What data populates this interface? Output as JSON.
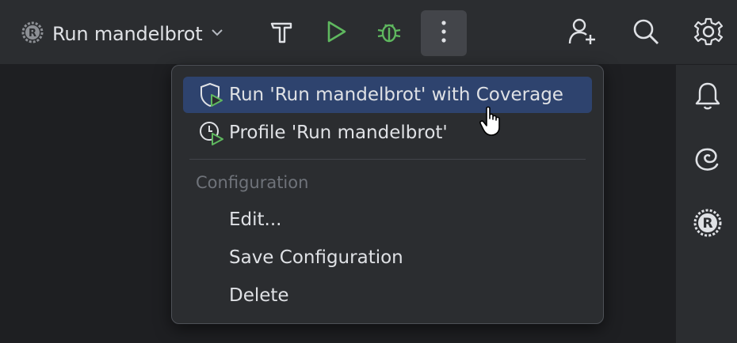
{
  "toolbar": {
    "run_config_label": "Run mandelbrot",
    "buttons": [
      "build-hammer",
      "run",
      "debug",
      "more-actions",
      "code-with-me",
      "search",
      "settings"
    ]
  },
  "menu": {
    "items": [
      {
        "label": "Run 'Run mandelbrot' with Coverage",
        "icon": "coverage-icon",
        "selected": true
      },
      {
        "label": "Profile 'Run mandelbrot'",
        "icon": "profile-icon",
        "selected": false
      }
    ],
    "section_header": "Configuration",
    "config_items": [
      {
        "label": "Edit..."
      },
      {
        "label": "Save Configuration"
      },
      {
        "label": "Delete"
      }
    ]
  },
  "colors": {
    "run_green": "#5fb85f",
    "selection": "#2e436e",
    "toolbar_bg": "#2b2d30",
    "editor_bg": "#1e1f22"
  }
}
